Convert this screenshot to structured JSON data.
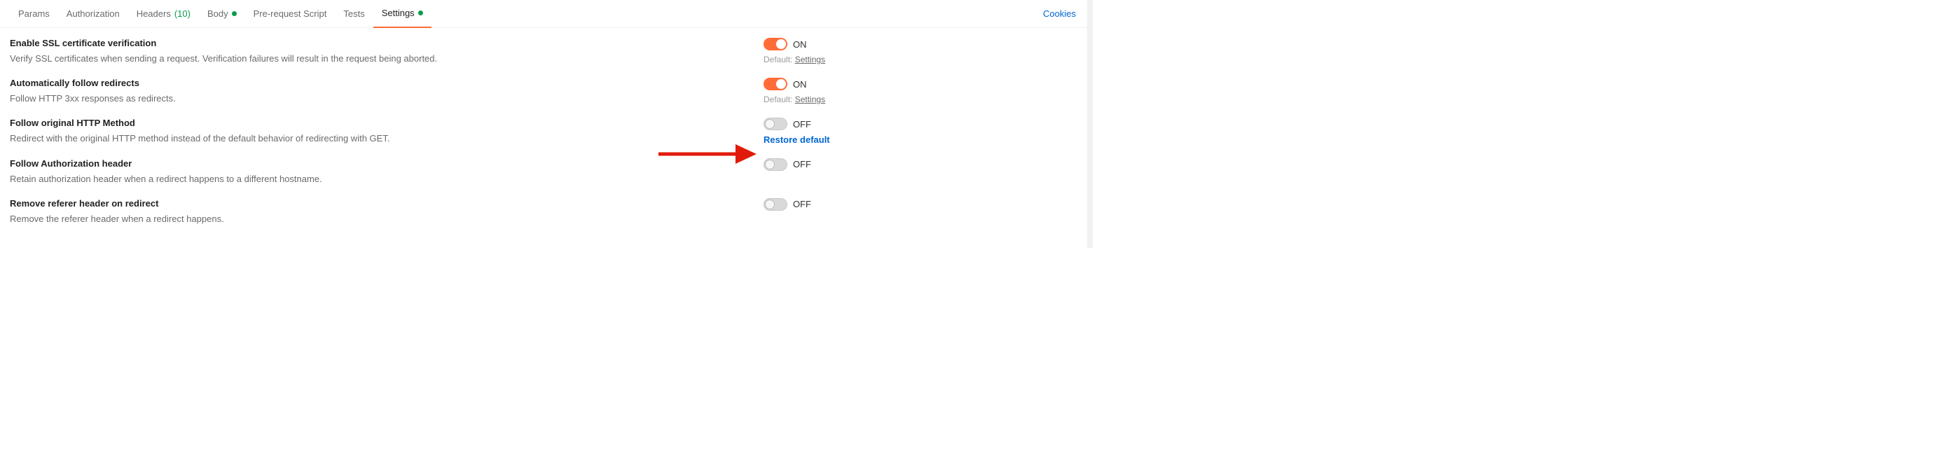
{
  "tabs": {
    "params": "Params",
    "authorization": "Authorization",
    "headers": "Headers",
    "headers_count": "(10)",
    "body": "Body",
    "prerequest": "Pre-request Script",
    "tests": "Tests",
    "settings": "Settings"
  },
  "cookies": "Cookies",
  "default_prefix": "Default: ",
  "default_link": "Settings",
  "restore_default": "Restore default",
  "on_label": "ON",
  "off_label": "OFF",
  "settings_items": [
    {
      "title": "Enable SSL certificate verification",
      "desc": "Verify SSL certificates when sending a request. Verification failures will result in the request being aborted.",
      "value": "ON",
      "on": true,
      "sub": "default"
    },
    {
      "title": "Automatically follow redirects",
      "desc": "Follow HTTP 3xx responses as redirects.",
      "value": "ON",
      "on": true,
      "sub": "default"
    },
    {
      "title": "Follow original HTTP Method",
      "desc": "Redirect with the original HTTP method instead of the default behavior of redirecting with GET.",
      "value": "OFF",
      "on": false,
      "sub": "restore"
    },
    {
      "title": "Follow Authorization header",
      "desc": "Retain authorization header when a redirect happens to a different hostname.",
      "value": "OFF",
      "on": false,
      "sub": "none"
    },
    {
      "title": "Remove referer header on redirect",
      "desc": "Remove the referer header when a redirect happens.",
      "value": "OFF",
      "on": false,
      "sub": "none"
    }
  ]
}
